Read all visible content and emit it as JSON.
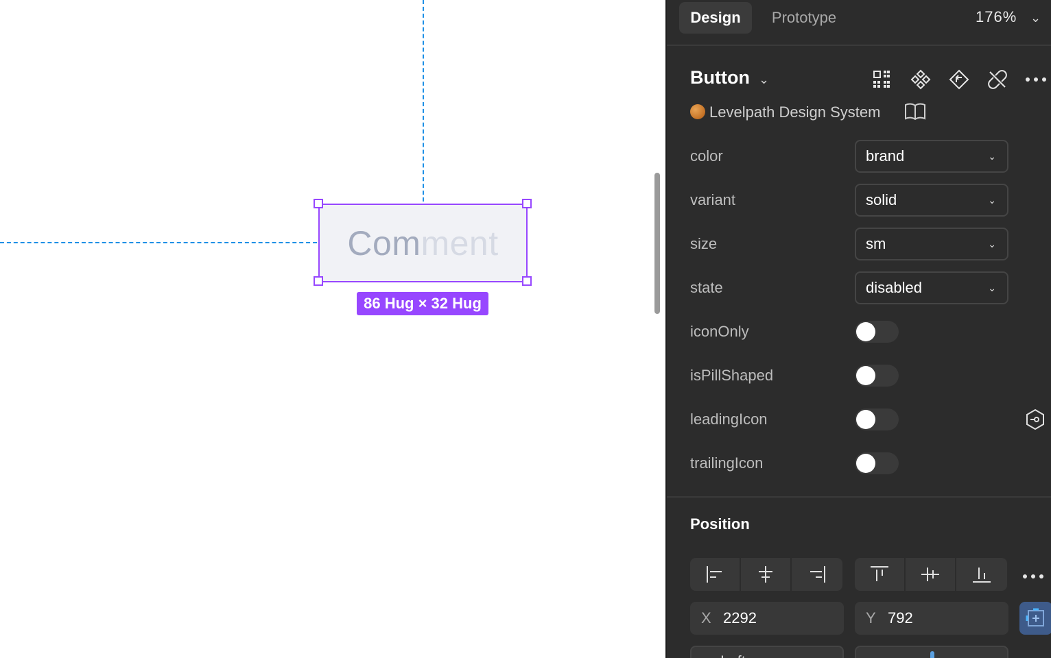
{
  "canvas": {
    "component_text_part1": "Com",
    "component_text_part2": "ment",
    "size_label": "86 Hug × 32 Hug"
  },
  "panel": {
    "tabs": [
      {
        "label": "Design",
        "active": true
      },
      {
        "label": "Prototype",
        "active": false
      }
    ],
    "zoom": "176%",
    "component_name": "Button",
    "library": "Levelpath Design System",
    "properties": [
      {
        "name": "color",
        "type": "select",
        "value": "brand"
      },
      {
        "name": "variant",
        "type": "select",
        "value": "solid"
      },
      {
        "name": "size",
        "type": "select",
        "value": "sm"
      },
      {
        "name": "state",
        "type": "select",
        "value": "disabled"
      },
      {
        "name": "iconOnly",
        "type": "toggle",
        "value": false
      },
      {
        "name": "isPillShaped",
        "type": "toggle",
        "value": false
      },
      {
        "name": "leadingIcon",
        "type": "toggle",
        "value": false
      },
      {
        "name": "trailingIcon",
        "type": "toggle",
        "value": false
      }
    ],
    "position": {
      "title": "Position",
      "x_label": "X",
      "x_value": "2292",
      "y_label": "Y",
      "y_value": "792",
      "constraint_partial": "… Left"
    }
  },
  "colors": {
    "selection": "#9747ff",
    "guide": "#1e90e6",
    "panel_bg": "#2c2c2c",
    "disabled_text": "#a3abbe"
  }
}
